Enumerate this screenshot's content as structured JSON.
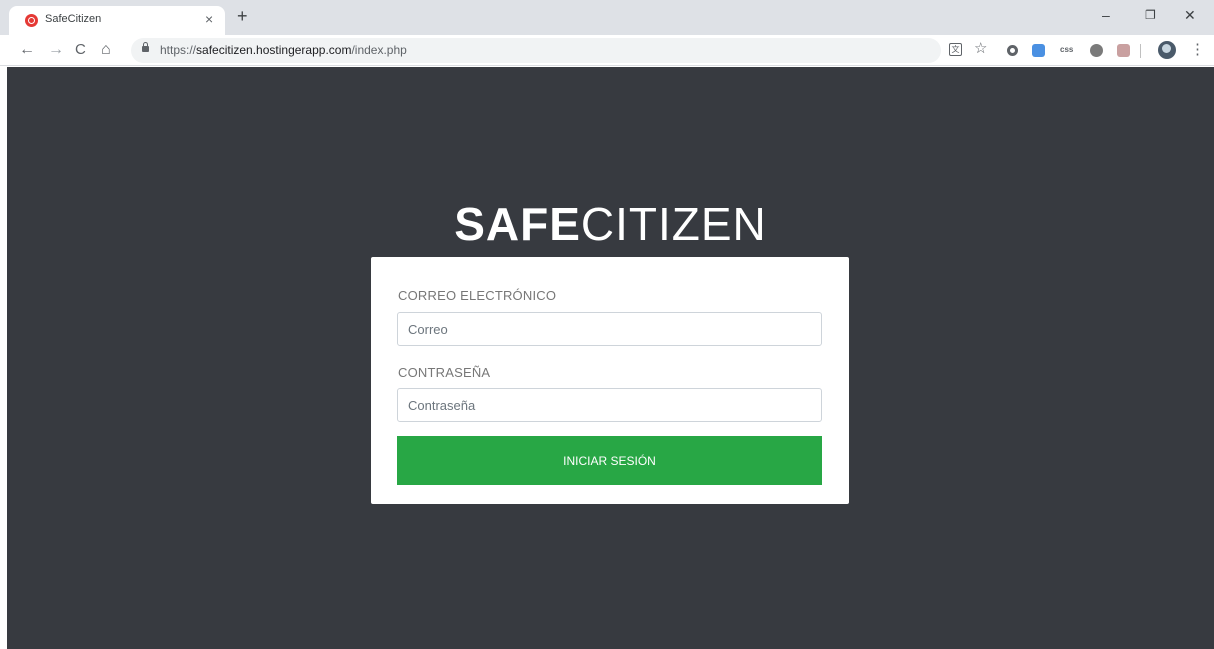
{
  "browser": {
    "tab_title": "SafeCitizen",
    "tab_close": "×",
    "new_tab": "+",
    "window_minimize": "–",
    "window_restore": "❐",
    "window_close": "✕",
    "url_scheme": "https://",
    "url_host": "safecitizen.hostingerapp.com",
    "url_path": "/index.php",
    "back": "←",
    "forward": "→",
    "reload": "C",
    "home": "⌂",
    "star": "☆",
    "translate": "文",
    "css_ext": "css",
    "menu": "⋮"
  },
  "page": {
    "logo_bold": "SAFE",
    "logo_thin": "CITIZEN",
    "email_label": "CORREO ELECTRÓNICO",
    "email_placeholder": "Correo",
    "email_value": "",
    "password_label": "CONTRASEÑA",
    "password_placeholder": "Contraseña",
    "password_value": "",
    "submit_label": "INICIAR SESIÓN"
  },
  "colors": {
    "background": "#373a40",
    "card": "#ffffff",
    "submit": "#28a745",
    "favicon": "#e53935"
  }
}
